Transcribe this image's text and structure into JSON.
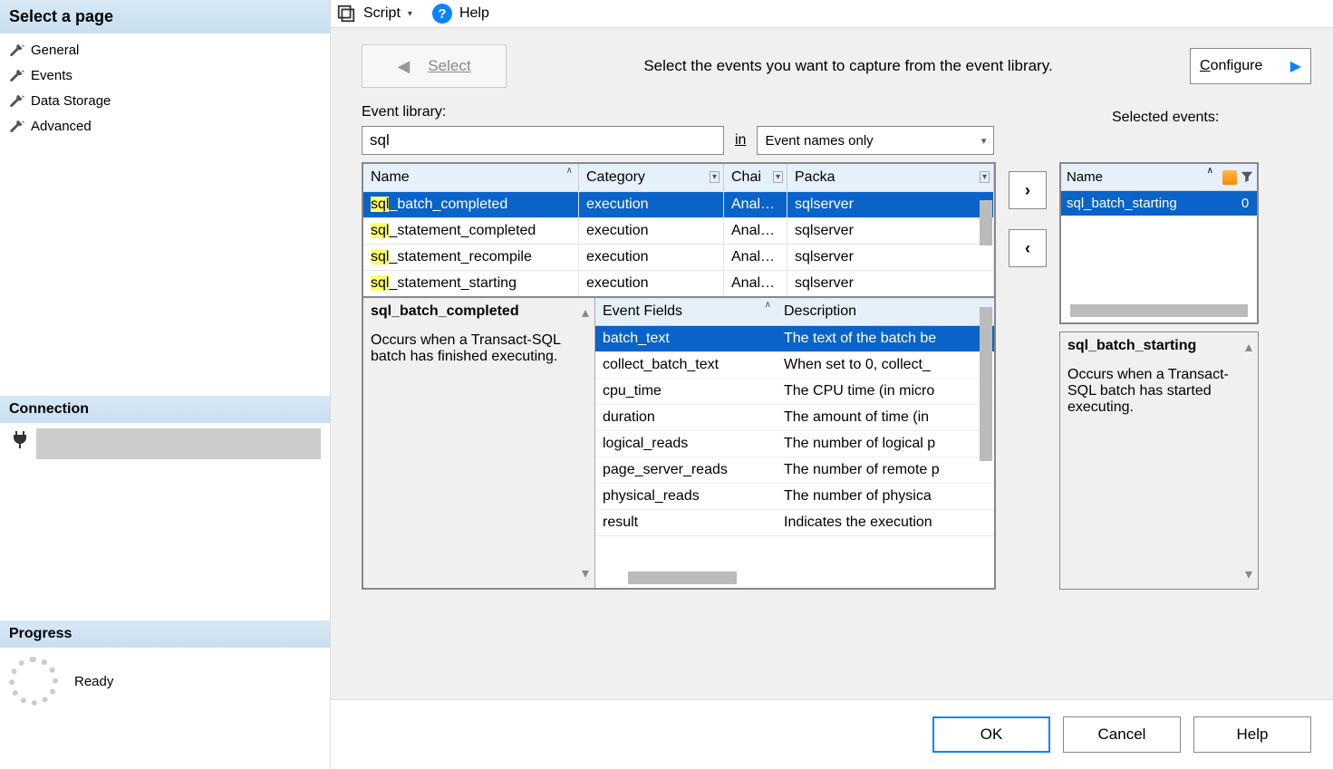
{
  "sidebar": {
    "header": "Select a page",
    "pages": [
      "General",
      "Events",
      "Data Storage",
      "Advanced"
    ],
    "connection_header": "Connection",
    "progress_header": "Progress",
    "progress_status": "Ready"
  },
  "toolbar": {
    "script": "Script",
    "help": "Help"
  },
  "wizard": {
    "select_btn": "Select",
    "message": "Select the events you want to capture from the event library.",
    "configure": "Configure"
  },
  "library": {
    "label": "Event library:",
    "search": "sql",
    "in_label": "in",
    "scope": "Event names only",
    "cols": {
      "name": "Name",
      "category": "Category",
      "channel": "Chai",
      "package": "Packa"
    },
    "rows": [
      {
        "name_hl": "sql",
        "name_rest": "_batch_completed",
        "category": "execution",
        "channel": "Analytic",
        "package": "sqlserver",
        "sel": true
      },
      {
        "name_hl": "sql",
        "name_rest": "_statement_completed",
        "category": "execution",
        "channel": "Analytic",
        "package": "sqlserver",
        "sel": false
      },
      {
        "name_hl": "sql",
        "name_rest": "_statement_recompile",
        "category": "execution",
        "channel": "Analytic",
        "package": "sqlserver",
        "sel": false
      },
      {
        "name_hl": "sql",
        "name_rest": "_statement_starting",
        "category": "execution",
        "channel": "Analytic",
        "package": "sqlserver",
        "sel": false
      }
    ]
  },
  "detail_left": {
    "title": "sql_batch_completed",
    "desc": "Occurs when a Transact-SQL batch has finished executing."
  },
  "fields": {
    "head_field": "Event Fields",
    "head_desc": "Description",
    "rows": [
      {
        "f": "batch_text",
        "d": "The text of the batch be",
        "sel": true
      },
      {
        "f": "collect_batch_text",
        "d": "When set to 0, collect_"
      },
      {
        "f": "cpu_time",
        "d": "The CPU time (in micro"
      },
      {
        "f": "duration",
        "d": "The amount of time (in "
      },
      {
        "f": "logical_reads",
        "d": "The number of logical p"
      },
      {
        "f": "page_server_reads",
        "d": "The number of remote p"
      },
      {
        "f": "physical_reads",
        "d": "The number of physica"
      },
      {
        "f": "result",
        "d": "Indicates the execution"
      }
    ]
  },
  "selected": {
    "label": "Selected events:",
    "col_name": "Name",
    "rows": [
      {
        "name": "sql_batch_starting",
        "n": "0"
      }
    ],
    "detail_title": "sql_batch_starting",
    "detail_desc": "Occurs when a Transact-SQL batch has started executing."
  },
  "footer": {
    "ok": "OK",
    "cancel": "Cancel",
    "help": "Help"
  }
}
